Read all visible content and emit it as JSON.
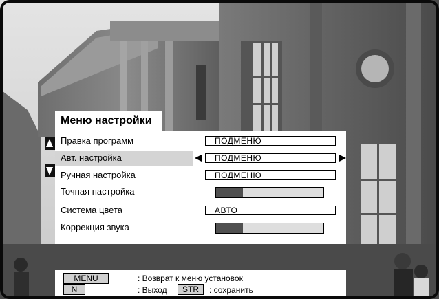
{
  "menu": {
    "title": "Меню настройки",
    "rows": [
      {
        "label": "Правка программ",
        "value": "ПОДМЕНЮ"
      },
      {
        "label": "Авт. настройка",
        "value": "ПОДМЕНЮ"
      },
      {
        "label": "Ручная настройка",
        "value": "ПОДМЕНЮ"
      },
      {
        "label": "Точная настройка",
        "level": 0.25
      },
      {
        "label": "Система цвета",
        "value": "АВТО"
      },
      {
        "label": "Коррекция звука",
        "level": 0.25
      }
    ],
    "selected_index": 1
  },
  "footer": {
    "menu_key": "MENU",
    "menu_text": ": Возврат к меню установок",
    "n_key": "N",
    "exit_text": ": Выход",
    "str_key": "STR",
    "save_text": ": сохранить"
  },
  "icons": {
    "scroll_up": "up-triangle-icon",
    "scroll_down": "down-triangle-icon",
    "value_left": "left-triangle-icon",
    "value_right": "right-triangle-icon"
  },
  "colors": {
    "panel": "#ffffff",
    "selection": "#d4d4d4",
    "slider_fill": "#505050",
    "slider_track": "#dedede"
  }
}
